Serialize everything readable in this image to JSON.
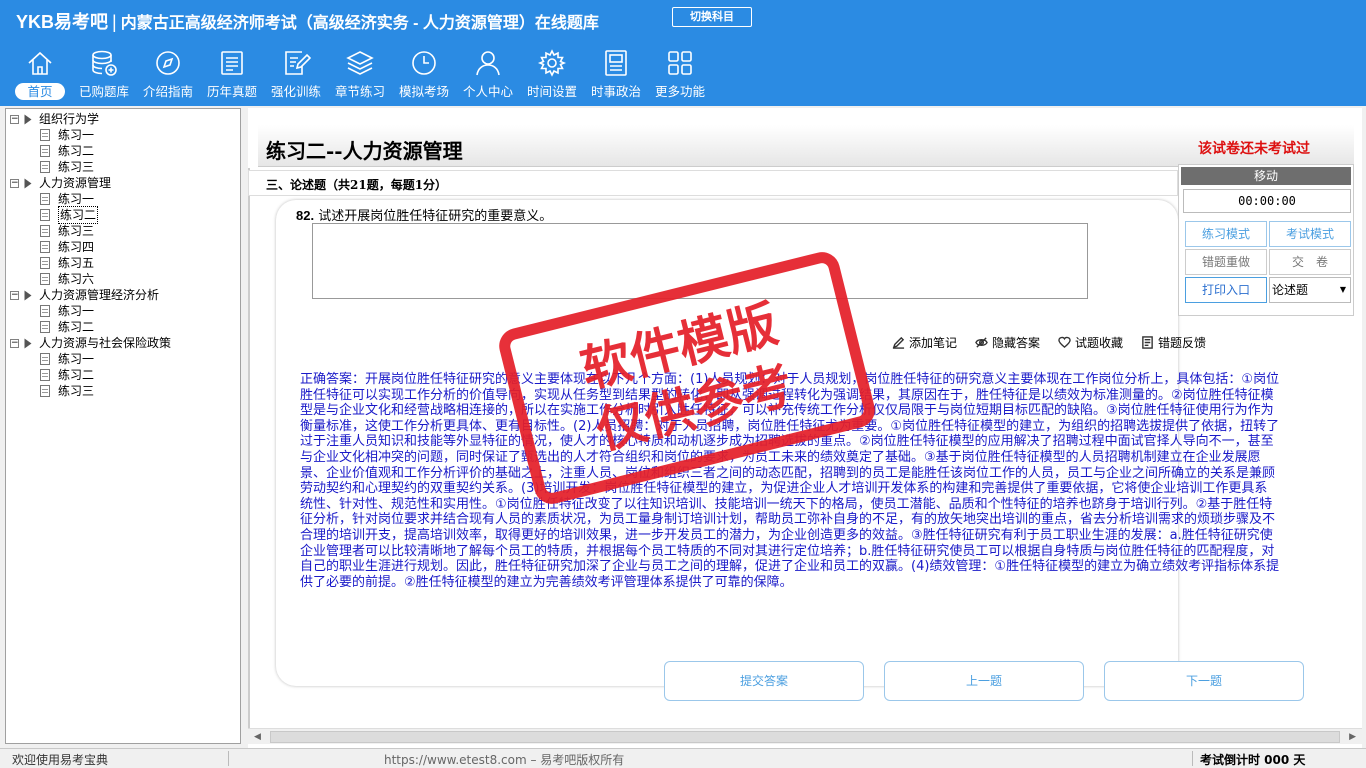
{
  "header": {
    "logo": "YKB易考吧",
    "separator": "|",
    "exam_title": "内蒙古正高级经济师考试（高级经济实务 - 人力资源管理）在线题库",
    "switch_label": "切换科目"
  },
  "nav": [
    {
      "label": "首页",
      "icon": "home-icon"
    },
    {
      "label": "已购题库",
      "icon": "database-plus-icon"
    },
    {
      "label": "介绍指南",
      "icon": "compass-icon"
    },
    {
      "label": "历年真题",
      "icon": "document-list-icon"
    },
    {
      "label": "强化训练",
      "icon": "edit-document-icon"
    },
    {
      "label": "章节练习",
      "icon": "layers-icon"
    },
    {
      "label": "模拟考场",
      "icon": "clock-icon"
    },
    {
      "label": "个人中心",
      "icon": "user-icon"
    },
    {
      "label": "时间设置",
      "icon": "gear-icon"
    },
    {
      "label": "时事政治",
      "icon": "notebook-icon"
    },
    {
      "label": "更多功能",
      "icon": "grid-icon"
    }
  ],
  "tree": [
    {
      "label": "组织行为学",
      "children": [
        "练习一",
        "练习二",
        "练习三"
      ]
    },
    {
      "label": "人力资源管理",
      "children": [
        "练习一",
        "练习二",
        "练习三",
        "练习四",
        "练习五",
        "练习六"
      ]
    },
    {
      "label": "人力资源管理经济分析",
      "children": [
        "练习一",
        "练习二"
      ]
    },
    {
      "label": "人力资源与社会保险政策",
      "children": [
        "练习一",
        "练习二",
        "练习三"
      ]
    }
  ],
  "main": {
    "paper_title": "练习二--人力资源管理",
    "not_taken": "该试卷还未考试过",
    "section_title": "三、论述题（共21题，每题1分）",
    "question_number": "82.",
    "question_text": "试述开展岗位胜任特征研究的重要意义。",
    "tools": {
      "add_note": "添加笔记",
      "hide_answer": "隐藏答案",
      "favorite": "试题收藏",
      "feedback": "错题反馈"
    },
    "correct_answer": "正确答案：开展岗位胜任特征研究的意义主要体现在以下几个方面：(1)人员规划：对于人员规划，岗位胜任特征的研究意义主要体现在工作岗位分析上，具体包括：①岗位胜任特征可以实现工作分析的价值导向，实现从任务型到结果型的转化，即从强调过程转化为强调结果，其原因在于，胜任特征是以绩效为标准测量的。②岗位胜任特征模型是与企业文化和经营战略相连接的，所以在实施工作分析时引入胜任特征，可以补充传统工作分析仅仅局限于与岗位短期目标匹配的缺陷。③岗位胜任特征使用行为作为衡量标准，这使工作分析更具体、更有目标性。(2)人员招聘：对于人员招聘，岗位胜任特征尤为重要。①岗位胜任特征模型的建立，为组织的招聘选拔提供了依据，扭转了过于注重人员知识和技能等外显特征的情况，使人才的核心特质和动机逐步成为招聘选拔的重点。②岗位胜任特征模型的应用解决了招聘过程中面试官择人导向不一，甚至与企业文化相冲突的问题，同时保证了甄选出的人才符合组织和岗位的要求，为员工未来的绩效奠定了基础。③基于岗位胜任特征模型的人员招聘机制建立在企业发展愿景、企业价值观和工作分析评价的基础之上，注重人员、岗位和组织三者之间的动态匹配，招聘到的员工是能胜任该岗位工作的人员，员工与企业之间所确立的关系是兼顾劳动契约和心理契约的双重契约关系。(3)培训开发：岗位胜任特征模型的建立，为促进企业人才培训开发体系的构建和完善提供了重要依据，它将使企业培训工作更具系统性、针对性、规范性和实用性。①岗位胜任特征改变了以往知识培训、技能培训一统天下的格局，使员工潜能、品质和个性特征的培养也跻身于培训行列。②基于胜任特征分析，针对岗位要求并结合现有人员的素质状况，为员工量身制订培训计划，帮助员工弥补自身的不足，有的放矢地突出培训的重点，省去分析培训需求的烦琐步骤及不合理的培训开支，提高培训效率，取得更好的培训效果，进一步开发员工的潜力，为企业创造更多的效益。③胜任特征研究有利于员工职业生涯的发展：a.胜任特征研究使企业管理者可以比较清晰地了解每个员工的特质，并根据每个员工特质的不同对其进行定位培养；b.胜任特征研究使员工可以根据自身特质与岗位胜任特征的匹配程度，对自己的职业生涯进行规划。因此，胜任特征研究加深了企业与员工之间的理解，促进了企业和员工的双赢。(4)绩效管理：①胜任特征模型的建立为确立绩效考评指标体系提供了必要的前提。②胜任特征模型的建立为完善绩效考评管理体系提供了可靠的保障。",
    "buttons": {
      "submit": "提交答案",
      "prev": "上一题",
      "next": "下一题"
    }
  },
  "panel": {
    "move": "移动",
    "timer": "00:00:00",
    "practice_mode": "练习模式",
    "exam_mode": "考试模式",
    "redo_wrong": "错题重做",
    "submit_paper": "交　卷",
    "print_entry": "打印入口",
    "question_type": "论述题"
  },
  "status": {
    "welcome": "欢迎使用易考宝典",
    "copyright": "https://www.etest8.com – 易考吧版权所有",
    "countdown": "考试倒计时 000 天"
  },
  "watermark": {
    "line1": "软件模版",
    "line2": "仅供参考"
  },
  "colors": {
    "header_blue": "#2b8be3",
    "answer_blue": "#1919c8",
    "alert_red": "#d11111",
    "stamp_red": "#e5202a"
  }
}
